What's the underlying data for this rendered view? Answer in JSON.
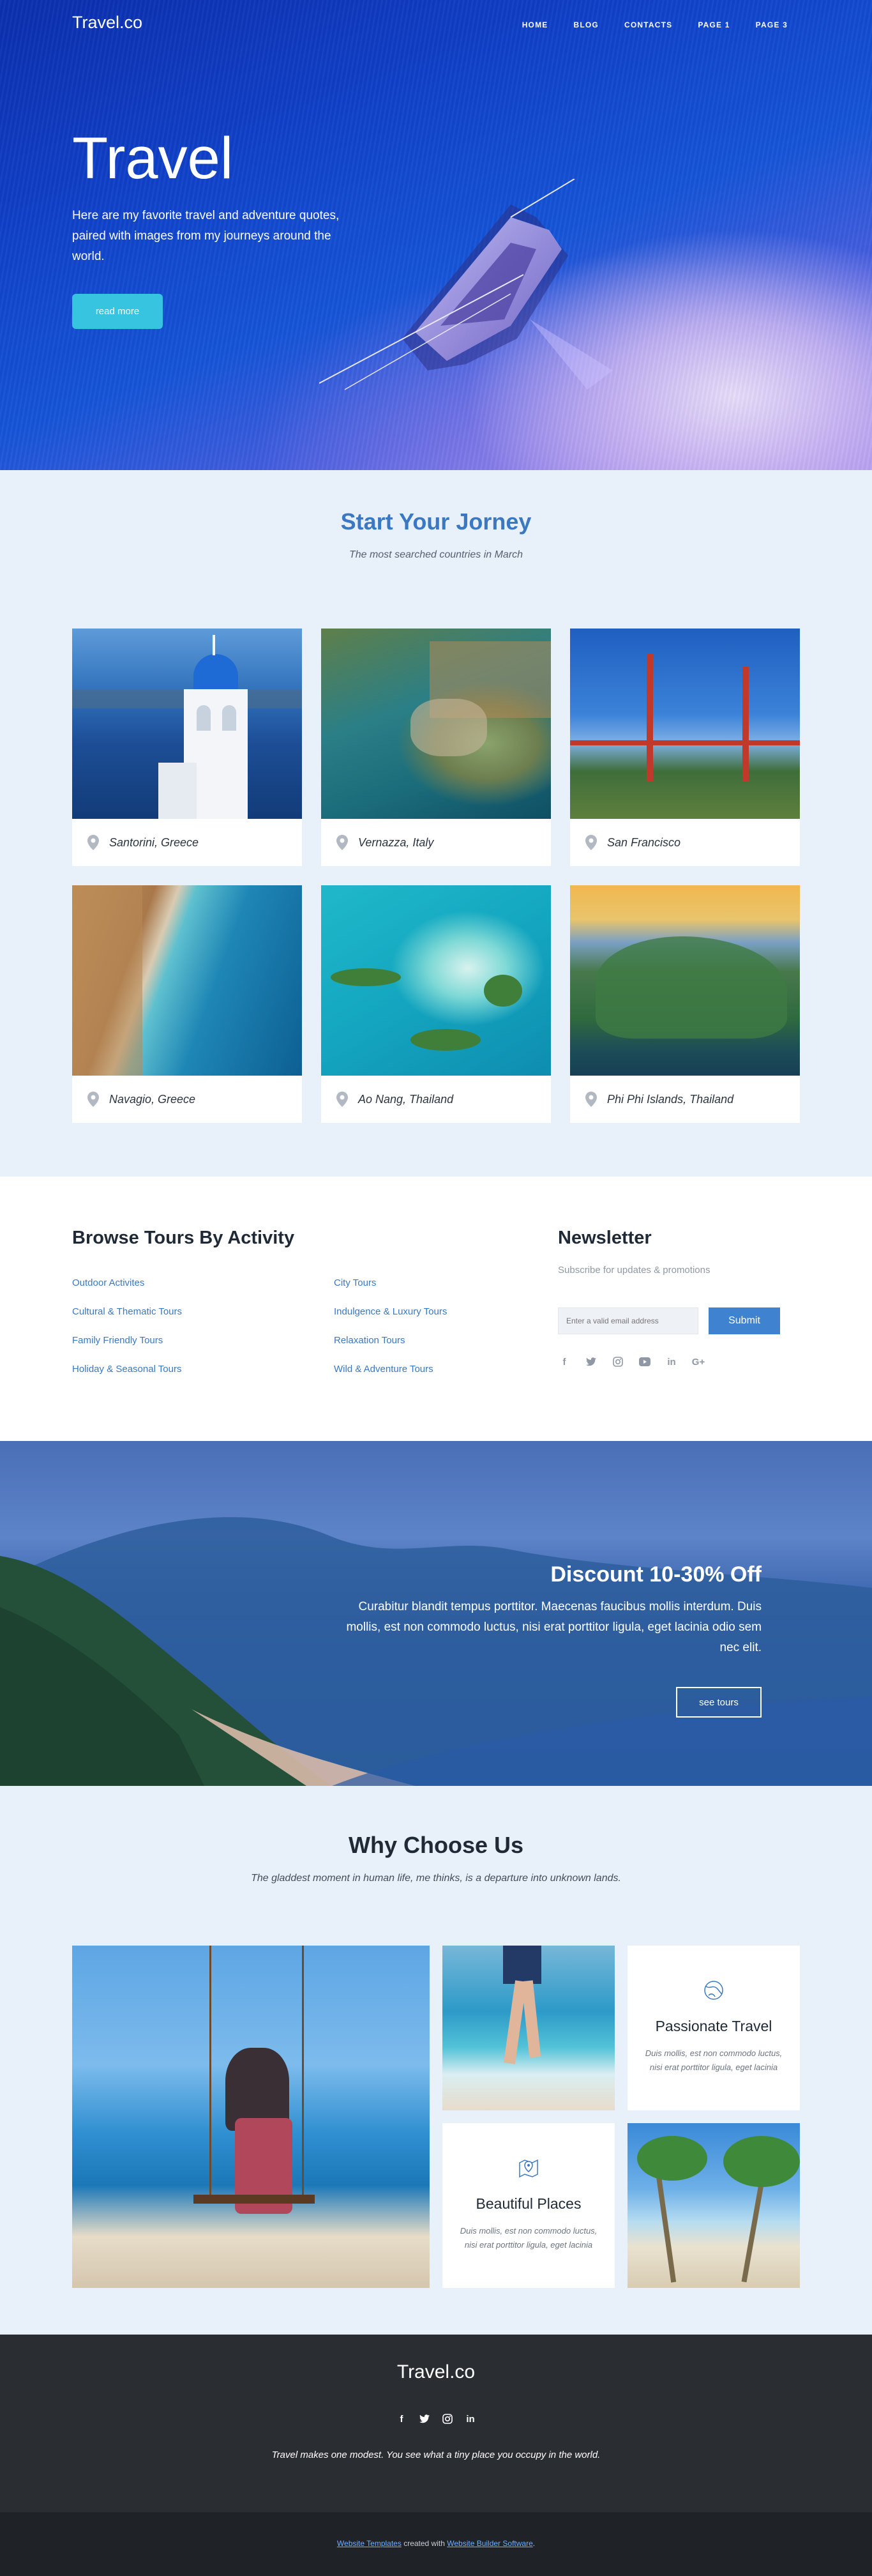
{
  "nav": {
    "brand": "Travel.co",
    "links": [
      "HOME",
      "BLOG",
      "CONTACTS",
      "PAGE 1",
      "PAGE 3"
    ]
  },
  "hero": {
    "title": "Travel",
    "text": "Here are my favorite travel and adventure quotes, paired with images from my journeys around the world.",
    "button": "read more"
  },
  "journey": {
    "title": "Start Your Jorney",
    "subtitle": "The most searched countries in March",
    "cards": [
      {
        "label": "Santorini, Greece",
        "icon": "map-pin-icon"
      },
      {
        "label": "Vernazza, Italy",
        "icon": "map-pin-icon"
      },
      {
        "label": "San Francisco",
        "icon": "map-pin-icon"
      },
      {
        "label": "Navagio, Greece",
        "icon": "map-pin-icon"
      },
      {
        "label": "Ao Nang, Thailand",
        "icon": "map-pin-icon"
      },
      {
        "label": "Phi Phi Islands, Thailand",
        "icon": "map-pin-icon"
      }
    ]
  },
  "browse": {
    "title": "Browse Tours By Activity",
    "col1": [
      "Outdoor Activites",
      "Cultural & Thematic Tours",
      "Family Friendly Tours",
      "Holiday & Seasonal Tours"
    ],
    "col2": [
      "City Tours",
      "Indulgence & Luxury Tours",
      "Relaxation Tours",
      "Wild & Adventure Tours"
    ]
  },
  "newsletter": {
    "title": "Newsletter",
    "subtitle": "Subscribe for updates & promotions",
    "placeholder": "Enter a valid email address",
    "button": "Submit",
    "social": [
      "facebook-icon",
      "twitter-icon",
      "instagram-icon",
      "youtube-icon",
      "linkedin-icon",
      "google-plus-icon"
    ]
  },
  "discount": {
    "title": "Discount 10-30% Off",
    "text": "Curabitur blandit tempus porttitor. Maecenas faucibus mollis interdum. Duis mollis, est non commodo luctus, nisi erat porttitor ligula, eget lacinia odio sem nec elit.",
    "button": "see tours"
  },
  "why": {
    "title": "Why Choose Us",
    "subtitle": "The gladdest moment in human life, me thinks, is a departure into unknown lands.",
    "features": [
      {
        "title": "Passionate Travel",
        "text": "Duis mollis, est non commodo luctus, nisi erat porttitor ligula, eget lacinia",
        "icon": "globe-icon"
      },
      {
        "title": "Beautiful Places",
        "text": "Duis mollis, est non commodo luctus, nisi erat porttitor ligula, eget lacinia",
        "icon": "map-icon"
      }
    ]
  },
  "footer": {
    "brand": "Travel.co",
    "text": "Travel makes one modest. You see what a tiny place you occupy in the world.",
    "social": [
      "facebook-icon",
      "twitter-icon",
      "instagram-icon",
      "linkedin-icon"
    ],
    "copyright_link1": "Website Templates",
    "copyright_mid": " created with ",
    "copyright_link2": "Website Builder Software",
    "copyright_end": "."
  },
  "colors": {
    "accent": "#3a78c2",
    "button_cyan": "#36c4e1",
    "submit_blue": "#3f82cf",
    "footer_dark": "#2a2d31"
  }
}
